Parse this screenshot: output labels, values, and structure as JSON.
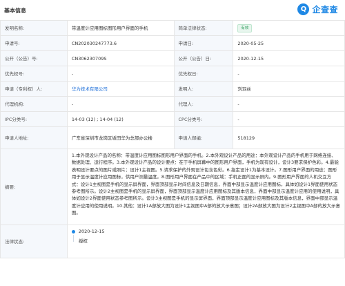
{
  "section_title": "基本信息",
  "logo": {
    "mark": "Q",
    "text": "企查查"
  },
  "rows": [
    {
      "l1": "发明名称:",
      "v1": "带温度计应用图标图形用户界面的手机",
      "l2": "简单法律状态:",
      "v2": "有效"
    },
    {
      "l1": "申请号:",
      "v1": "CN202030247773.6",
      "l2": "申请日:",
      "v2": "2020-05-25"
    },
    {
      "l1": "公开（公告）号:",
      "v1": "CN306230709S",
      "l2": "公开（公告）日:",
      "v2": "2020-12-15"
    },
    {
      "l1": "优先权号:",
      "v1": "-",
      "l2": "优先权日:",
      "v2": "-"
    },
    {
      "l1": "申请（专利权）人:",
      "v1": "华为技术有限公司",
      "l2": "发明人:",
      "v2": "刘羽丝"
    },
    {
      "l1": "代理机构:",
      "v1": "-",
      "l2": "代理人:",
      "v2": "-"
    },
    {
      "l1": "IPC分类号:",
      "v1": "14-03 (12) ; 14-04 (12)",
      "l2": "CPC分类号:",
      "v2": "-"
    },
    {
      "l1": "申请人地址:",
      "v1": "广东省深圳市龙岗区坂田华为总部办公楼",
      "l2": "申请人邮编:",
      "v2": "518129"
    }
  ],
  "abstract_label": "摘要:",
  "abstract": "1.本外观设计产品的名称：带温度计应用图标图形用户界面的手机。2.本外观设计产品的用途：本外观设计产品的手机用于网络连接、数据处理、运行程序。3.本外观设计产品的设计要点：在于手机屏幕中的图形用户界面，手机为现有设计，设计3要求保护色彩。4.最能表明设计要点的图片或照片：设计1主视图。5.请求保护的外观设计包含色彩。6.指定设计1为基本设计。7.图形用户界面的用途：图形用于显示温度计应用图标，供用户测量温度。8.图形用户界面在产品中的区域：手机正面的显示屏内。9.图形用户界面的人机交互方式：设计1主视图是手机的显示屏界面，界面顶部显示时间信息及日期信息，界面中部显示温度计应用图标，具体如设计1界面使用状态参考图所示。设计2主视图是手机的显示屏界面，界面顶部显示温度计应用图标及其版本信息，界面中部显示温度计应用的使用说明，具体如设计2界面使用状态参考图所示。设计3主视图是手机的显示屏界面，界面顶部显示温度计应用图标及其版本信息，界面中部显示温度计应用的使用说明。10.其他：设计1A部放大图为设计1主视图中A部的放大示意图；设计2A部放大图为设计2主视图中A部的放大示意图。",
  "status_label": "法律状态:",
  "status": {
    "date": "2020-12-15",
    "text": "授权"
  }
}
